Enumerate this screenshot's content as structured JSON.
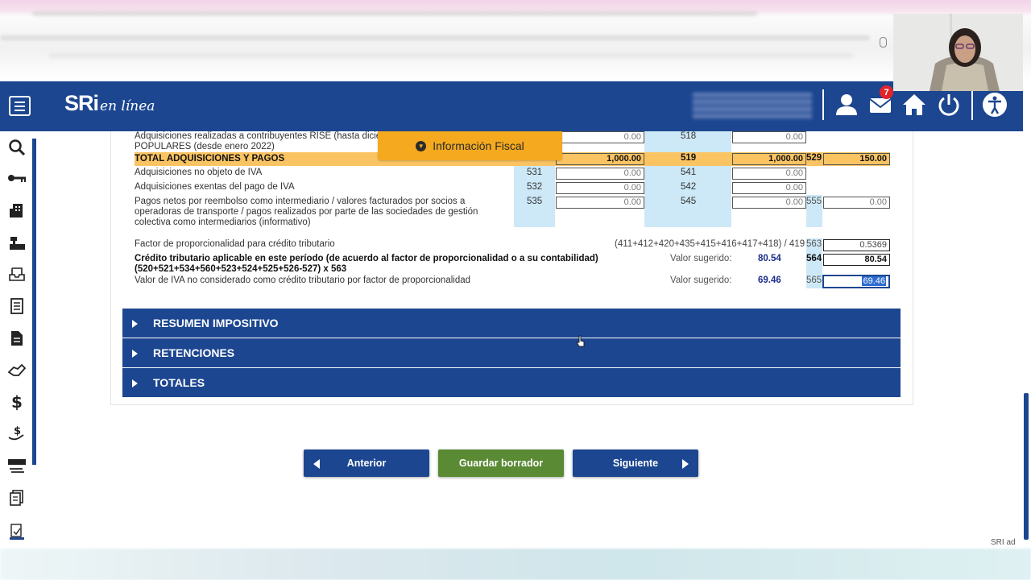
{
  "header": {
    "logo_main": "SRi",
    "logo_tag": "en línea",
    "mail_badge": "7",
    "icons": [
      "menu-icon",
      "user-icon",
      "mail-icon",
      "home-icon",
      "power-icon",
      "accessibility-icon"
    ]
  },
  "sidebar": {
    "icons": [
      "search-icon",
      "key-icon",
      "building-icon",
      "cash-register-icon",
      "tray-icon",
      "document-list-icon",
      "document-icon",
      "handshake-icon",
      "dollar-icon",
      "hand-dollar-icon",
      "calculator-transfer-icon",
      "receipt-icon",
      "signed-document-icon"
    ]
  },
  "info_tab": {
    "label": "Información Fiscal"
  },
  "rows": [
    {
      "label": "Adquisiciones realizadas a contribuyentes RISE (hasta dicie",
      "label2": "POPULARES (desde enero 2022)",
      "code2": "518",
      "val1": "0.00",
      "val2": "0.00"
    },
    {
      "label": "TOTAL ADQUISICIONES Y PAGOS",
      "code2": "519",
      "code3": "529",
      "val1": "1,000.00",
      "val2": "1,000.00",
      "val3": "150.00"
    },
    {
      "label": "Adquisiciones no objeto de IVA",
      "code1": "531",
      "code2": "541",
      "val1": "0.00",
      "val2": "0.00"
    },
    {
      "label": "Adquisiciones exentas del pago de IVA",
      "code1": "532",
      "code2": "542",
      "val1": "0.00",
      "val2": "0.00"
    },
    {
      "label": "Pagos netos por reembolso como intermediario / valores facturados por socios a",
      "label2": "operadoras de transporte / pagos realizados por parte de las sociedades de gestión",
      "label3": "colectiva como intermediarios (informativo)",
      "code1": "535",
      "code2": "545",
      "code3": "555",
      "val1": "0.00",
      "val2": "0.00",
      "val3": "0.00"
    }
  ],
  "factor": {
    "label": "Factor de proporcionalidad para crédito tributario",
    "formula": "(411+412+420+435+415+416+417+418) / 419",
    "code": "563",
    "value": "0.5369"
  },
  "credito": {
    "label": "Crédito tributario aplicable en este período (de acuerdo al factor de proporcionalidad o a su contabilidad)",
    "label2": "(520+521+534+560+523+524+525+526-527) x 563",
    "valor_label": "Valor sugerido:",
    "valor": "80.54",
    "code": "564",
    "value": "80.54"
  },
  "no_considerado": {
    "label": "Valor de IVA no considerado como crédito tributario por factor de proporcionalidad",
    "valor_label": "Valor sugerido:",
    "valor": "69.46",
    "code": "565",
    "value": "69.46"
  },
  "accordions": [
    "RESUMEN IMPOSITIVO",
    "RETENCIONES",
    "TOTALES"
  ],
  "buttons": {
    "anterior": "Anterior",
    "guardar": "Guardar borrador",
    "siguiente": "Siguiente"
  },
  "footer": {
    "right_text": "SRI ad"
  }
}
